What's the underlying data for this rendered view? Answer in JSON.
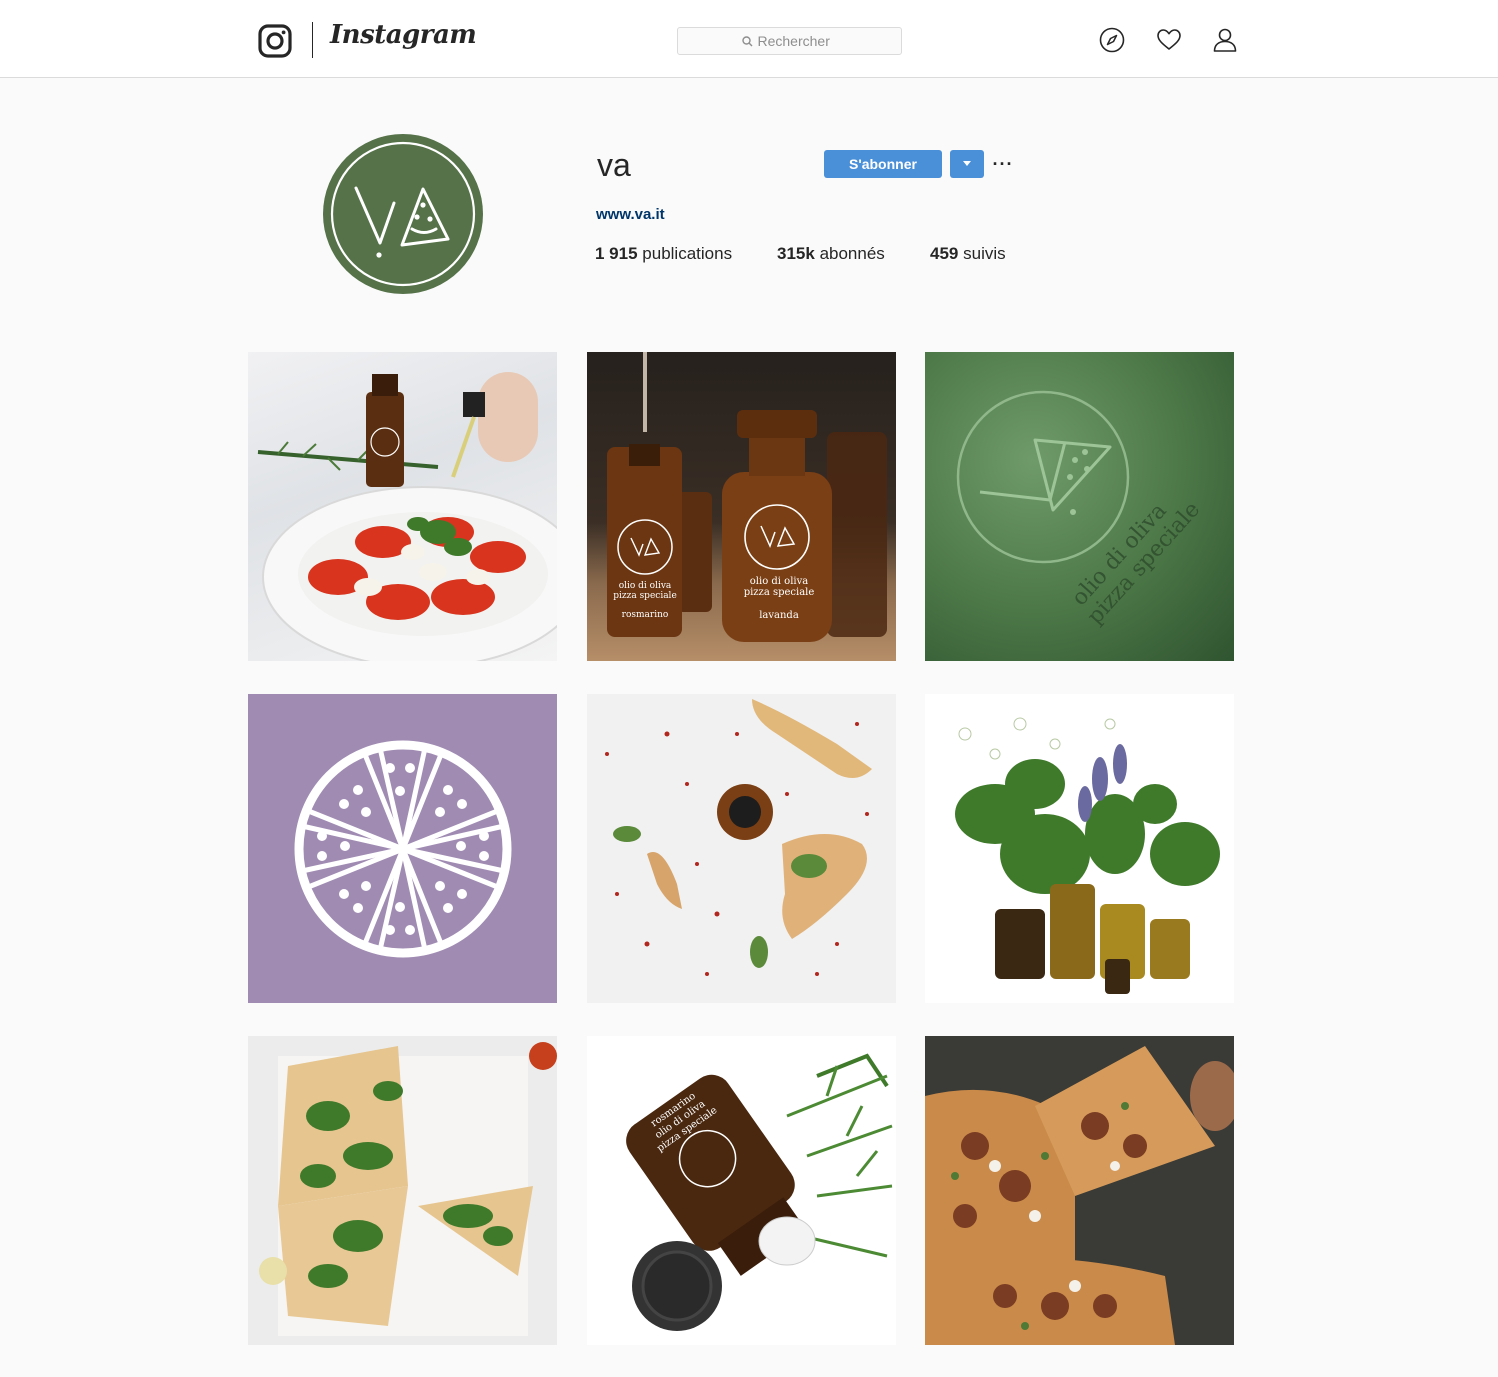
{
  "header": {
    "brand": "Instagram",
    "search_placeholder": "Rechercher"
  },
  "profile": {
    "username": "va",
    "follow_label": "S'abonner",
    "website": "www.va.it",
    "stats": [
      {
        "count": "1 915",
        "label": "publications"
      },
      {
        "count": "315k",
        "label": "abonnés"
      },
      {
        "count": "459",
        "label": "suivis"
      }
    ]
  },
  "posts": {
    "p2": {
      "b1_line1": "olio di oliva",
      "b1_line2": "pizza speciale",
      "b1_line3": "rosmarino",
      "b2_line1": "olio di oliva",
      "b2_line2": "pizza speciale",
      "b2_line3": "lavanda"
    },
    "p3": {
      "line1": "olio di oliva",
      "line2": "pizza speciale"
    },
    "p8": {
      "line1": "olio di oliva",
      "line2": "pizza speciale",
      "line3": "rosmarino"
    }
  },
  "colors": {
    "brand_green": "#557249",
    "follow_blue": "#4a90d9",
    "link_blue": "#003569",
    "lavender": "#a08bb3"
  },
  "icons": [
    "instagram-camera-icon",
    "search-icon",
    "compass-icon",
    "heart-icon",
    "user-icon",
    "chevron-down-icon",
    "more-options-icon"
  ]
}
